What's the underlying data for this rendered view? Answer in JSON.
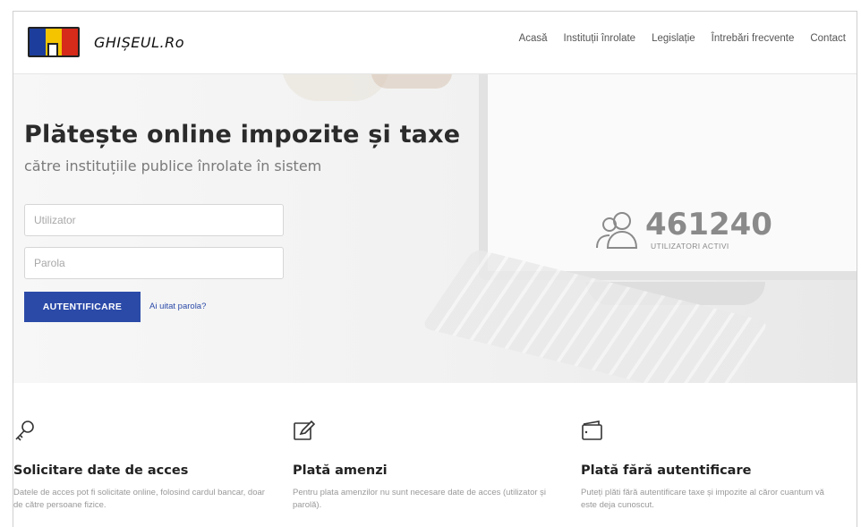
{
  "header": {
    "logo_text": "GHIȘEUL.Ro",
    "nav": [
      "Acasă",
      "Instituții înrolate",
      "Legislație",
      "Întrebări frecvente",
      "Contact"
    ]
  },
  "hero": {
    "title": "Plătește online impozite și taxe",
    "subtitle": "către instituțiile publice înrolate în sistem",
    "username_placeholder": "Utilizator",
    "password_placeholder": "Parola",
    "login_button": "AUTENTIFICARE",
    "forgot_link": "Ai uitat parola?",
    "stats_number": "461240",
    "stats_label": "UTILIZATORI ACTIVI"
  },
  "features": [
    {
      "icon": "key-icon",
      "title": "Solicitare date de acces",
      "desc": "Datele de acces pot fi solicitate online, folosind cardul bancar, doar de către persoane fizice."
    },
    {
      "icon": "edit-icon",
      "title": "Plată amenzi",
      "desc": "Pentru plata amenzilor nu sunt necesare date de acces (utilizator și parolă)."
    },
    {
      "icon": "wallet-icon",
      "title": "Plată fără autentificare",
      "desc": "Puteți plăti fără autentificare taxe și impozite al căror cuantum vă este deja cunoscut."
    }
  ],
  "colors": {
    "primary": "#2b4aa8",
    "flag_blue": "#1c3d9c",
    "flag_yellow": "#f5c400",
    "flag_red": "#d62a1a"
  }
}
